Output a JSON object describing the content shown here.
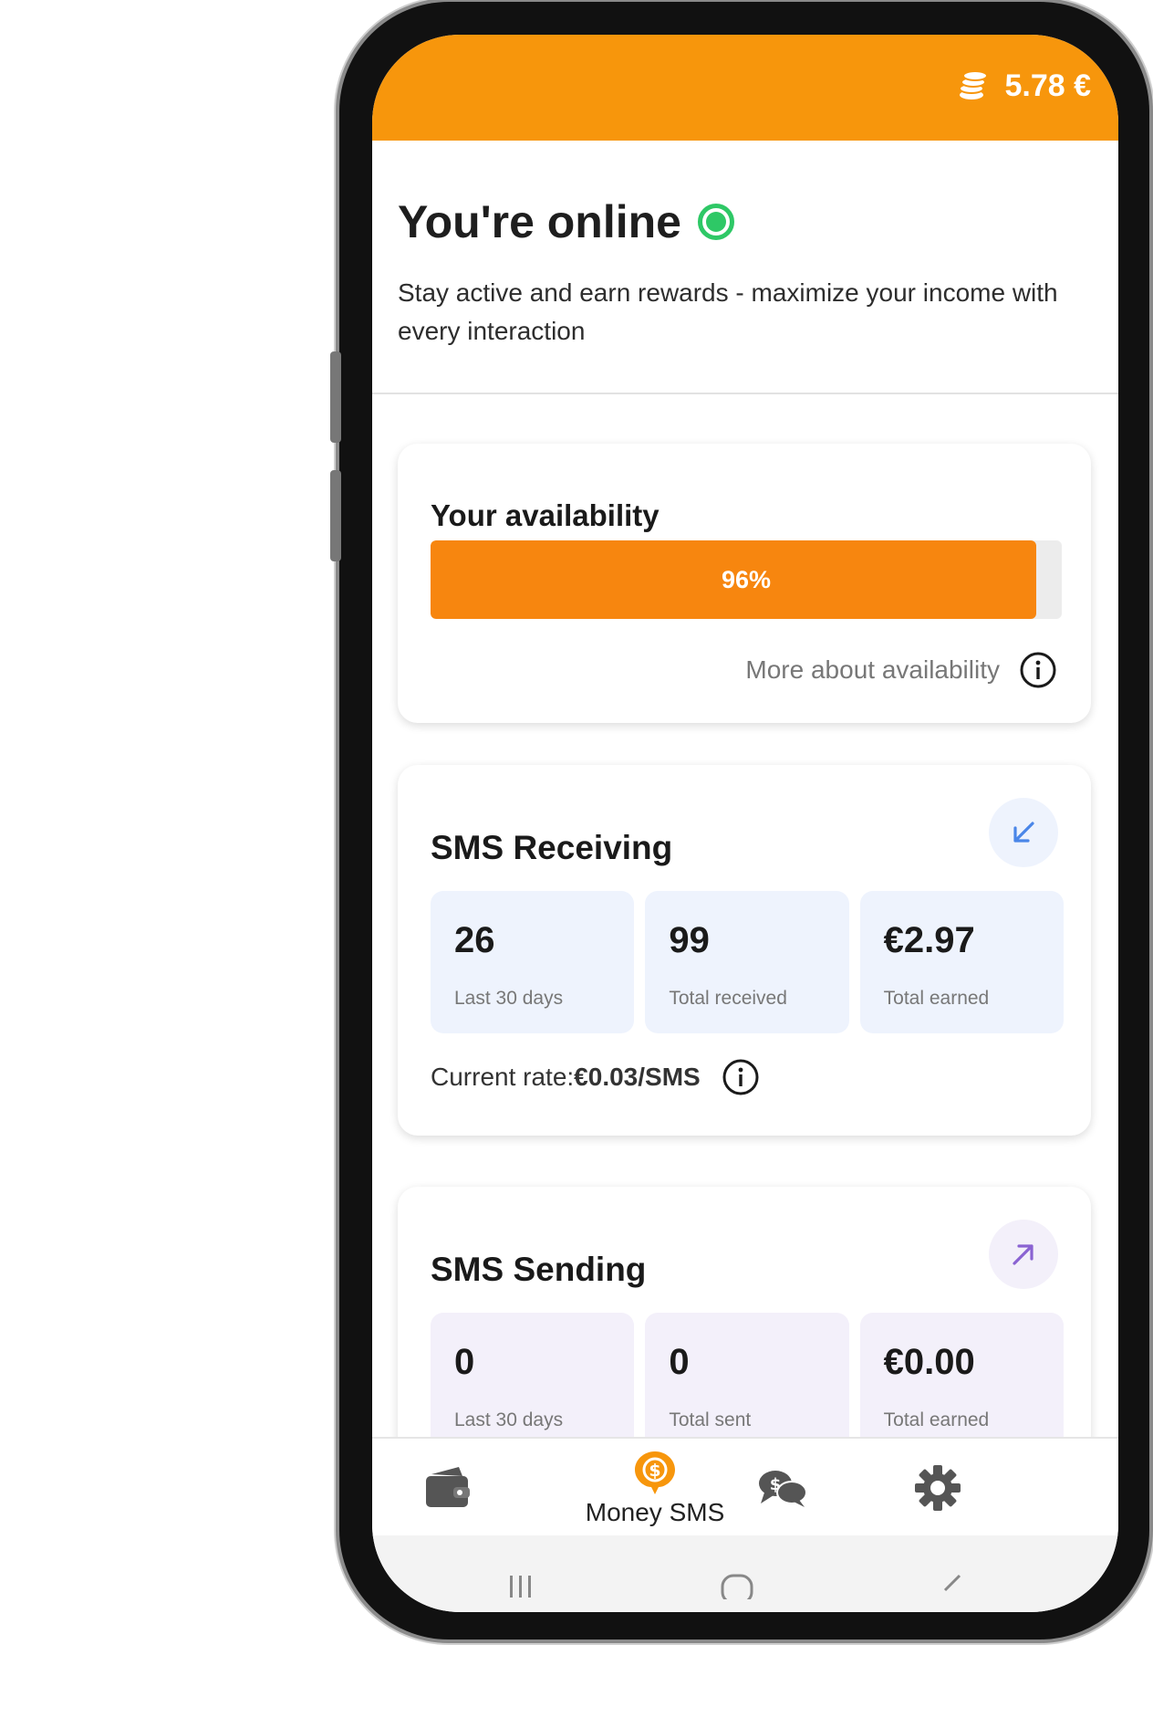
{
  "header": {
    "balance": "5.78 €"
  },
  "status": {
    "title": "You're online",
    "subtitle": "Stay active and earn rewards - maximize your income with every interaction"
  },
  "availability": {
    "title": "Your availability",
    "percent": 96,
    "percent_label": "96%",
    "more_link": "More about availability"
  },
  "receiving": {
    "title": "SMS Receiving",
    "stats": [
      {
        "value": "26",
        "label": "Last 30 days"
      },
      {
        "value": "99",
        "label": "Total received"
      },
      {
        "value": "€2.97",
        "label": "Total earned"
      }
    ],
    "rate_prefix": "Current rate:",
    "rate_value": "€0.03/SMS"
  },
  "sending": {
    "title": "SMS Sending",
    "stats": [
      {
        "value": "0",
        "label": "Last 30 days"
      },
      {
        "value": "0",
        "label": "Total sent"
      },
      {
        "value": "€0.00",
        "label": "Total earned"
      }
    ]
  },
  "nav": {
    "active_label": "Money SMS",
    "items": [
      "wallet-icon",
      "money-sms-icon",
      "chat-money-icon",
      "settings-gear-icon"
    ]
  },
  "colors": {
    "brand_orange": "#f7960c",
    "bar_orange": "#f7860f",
    "online_green": "#2ec866",
    "receive_tint": "#eef3fd",
    "send_tint": "#f3f0fa",
    "receive_icon": "#4a86e8",
    "send_icon": "#8a63d2"
  }
}
